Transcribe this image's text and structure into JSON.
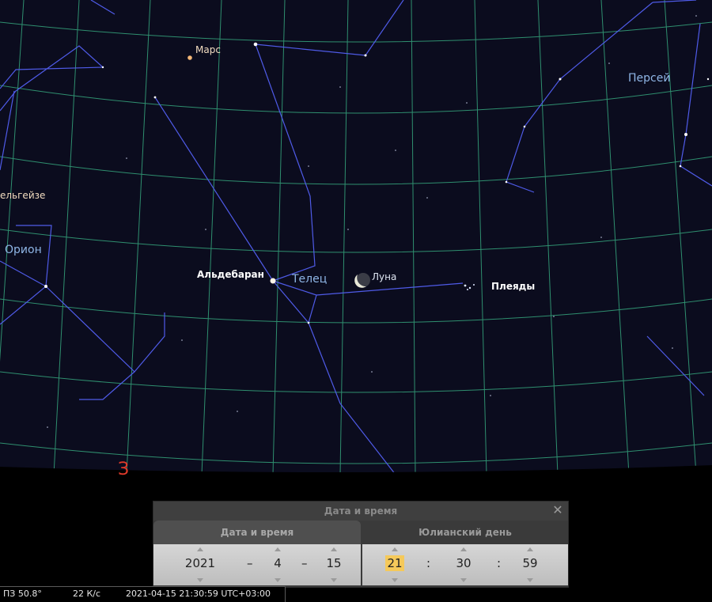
{
  "sky": {
    "labels": {
      "mars": "Марс",
      "perseus": "Персей",
      "betelgeuse": "ельгейзе",
      "orion": "Орион",
      "aldebaran": "Альдебаран",
      "taurus": "Телец",
      "moon": "Луна",
      "pleiades": "Плеяды",
      "direction": "З"
    },
    "colors": {
      "background": "#0b0c1e",
      "grid": "#2f8f6f",
      "constellation_lines": "#4f5be8",
      "ground": "#000000"
    }
  },
  "dialog": {
    "title": "Дата и время",
    "close_icon": "close-icon",
    "tabs": [
      {
        "label": "Дата и время"
      },
      {
        "label": "Юлианский день"
      }
    ],
    "date": {
      "year": "2021",
      "month": "4",
      "day": "15",
      "separator": "–"
    },
    "time": {
      "hour": "21",
      "minute": "30",
      "second": "59",
      "separator": ":"
    }
  },
  "statusbar": {
    "fov": "ПЗ 50.8°",
    "fps": "22 К/с",
    "datetime": "2021-04-15 21:30:59 UTC+03:00"
  }
}
